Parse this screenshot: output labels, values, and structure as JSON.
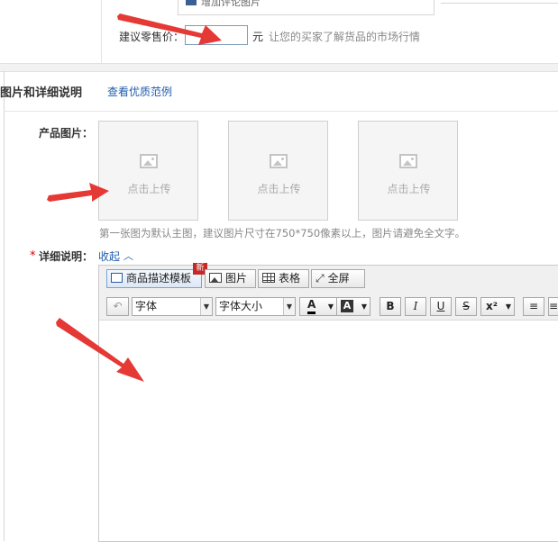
{
  "top": {
    "cut_text": "增加评论图片",
    "price_label": "建议零售价：",
    "price_value": "",
    "currency": "元",
    "price_hint": "让您的买家了解货品的市场行情"
  },
  "section": {
    "title": "图片和详细说明",
    "example_link": "查看优质范例"
  },
  "product_images": {
    "label": "产品图片：",
    "upload_text": [
      "点击上传",
      "点击上传",
      "点击上传"
    ],
    "hint": "第一张图为默认主图，建议图片尺寸在750*750像素以上，图片请避免全文字。"
  },
  "detail": {
    "required_mark": "*",
    "label": "详细说明：",
    "collapse": "收起",
    "collapse_icon": "chevron-up-icon"
  },
  "toolbar": {
    "template_label": "商品描述模板",
    "new_badge": "新",
    "image_label": "图片",
    "table_label": "表格",
    "fullscreen_label": "全屏",
    "undo_glyph": "↶",
    "font_value": "字体",
    "font_size_value": "字体大小",
    "font_color_glyph": "A",
    "bg_color_glyph": "A",
    "bold": "B",
    "italic": "I",
    "underline": "U",
    "strike": "S",
    "superscript": "x²",
    "align": "≡"
  },
  "colors": {
    "link": "#1f5dad",
    "required": "#dd0000",
    "annotation_arrow": "#e53935",
    "badge": "#c62828"
  }
}
